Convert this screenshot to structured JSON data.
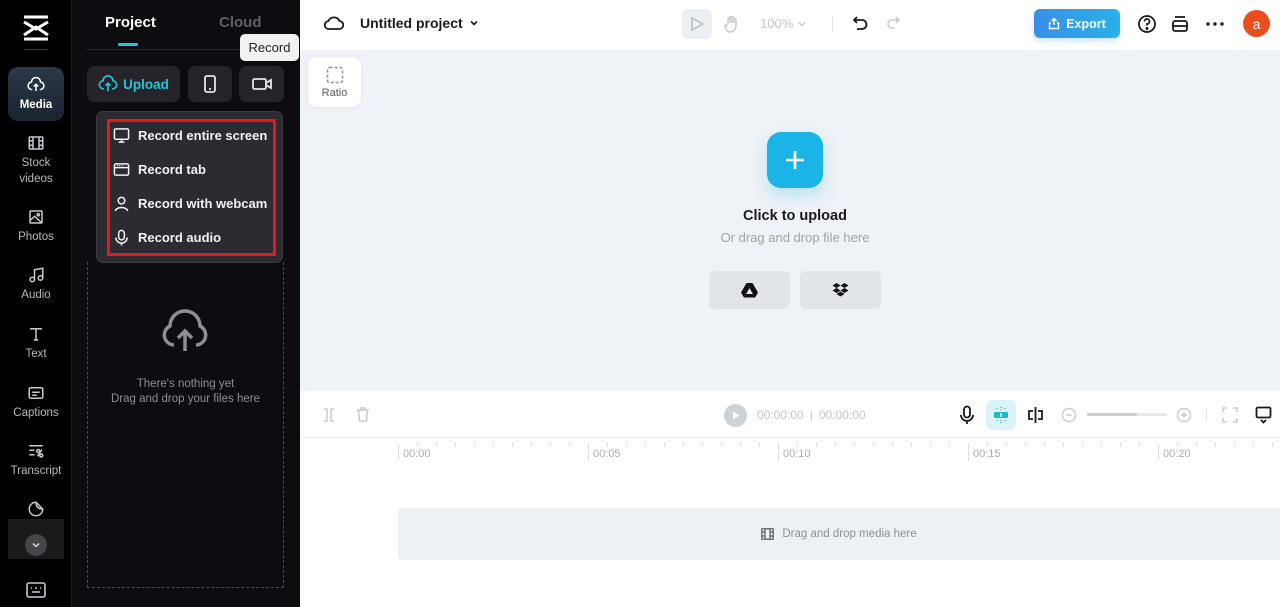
{
  "rail": {
    "logo": "capcut-logo-icon",
    "items": [
      {
        "label": "Media",
        "icon": "cloud-upload-icon",
        "active": true
      },
      {
        "label": "Stock videos",
        "icon": "film-icon"
      },
      {
        "label": "Photos",
        "icon": "image-icon"
      },
      {
        "label": "Audio",
        "icon": "music-note-icon"
      },
      {
        "label": "Text",
        "icon": "text-t-icon"
      },
      {
        "label": "Captions",
        "icon": "captions-icon"
      },
      {
        "label": "Transcript",
        "icon": "transcript-icon"
      },
      {
        "label": "Stickers",
        "icon": "sticker-icon"
      }
    ],
    "more_icon": "chevron-down-icon",
    "bottom_icon": "keyboard-icon"
  },
  "panel": {
    "tabs": [
      {
        "label": "Project",
        "active": true
      },
      {
        "label": "Cloud",
        "active": false
      }
    ],
    "upload_label": "Upload",
    "tooltip": "Record",
    "record_menu": [
      {
        "label": "Record entire screen",
        "icon": "monitor-icon"
      },
      {
        "label": "Record tab",
        "icon": "browser-tab-icon"
      },
      {
        "label": "Record with webcam",
        "icon": "person-icon"
      },
      {
        "label": "Record audio",
        "icon": "microphone-icon"
      }
    ],
    "empty_title": "There's nothing yet",
    "empty_subtitle": "Drag and drop your files here"
  },
  "topbar": {
    "project_title": "Untitled project",
    "zoom_level": "100%",
    "export_label": "Export",
    "avatar_letter": "a"
  },
  "canvas": {
    "ratio_label": "Ratio",
    "upload_title": "Click to upload",
    "upload_subtitle": "Or drag and drop file here",
    "cloud_sources": [
      "google-drive-icon",
      "dropbox-icon"
    ]
  },
  "timeline": {
    "current_time": "00:00:00",
    "separator": "|",
    "total_time": "00:00:00",
    "zoom_fraction": 0.62,
    "ruler_labels": [
      "00:00",
      "00:05",
      "00:10",
      "00:15",
      "00:20"
    ],
    "track_placeholder": "Drag and drop media here"
  },
  "colors": {
    "accent": "#22c5dc",
    "upload_button": "#1ab5e6",
    "export_start": "#3b8ee6",
    "export_end": "#28b2ea",
    "avatar": "#ea4e1c",
    "highlight": "#e11a22"
  }
}
